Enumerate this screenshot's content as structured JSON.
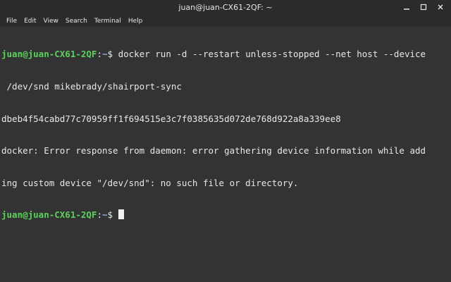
{
  "window": {
    "title": "juan@juan-CX61-2QF: ~",
    "buttons": {
      "minimize": "–",
      "maximize": "□",
      "close": "✕"
    }
  },
  "menu": {
    "items": [
      "File",
      "Edit",
      "View",
      "Search",
      "Terminal",
      "Help"
    ]
  },
  "terminal": {
    "prompt": {
      "user_host": "juan@juan-CX61-2QF",
      "colon": ":",
      "path": "~",
      "symbol": "$ "
    },
    "lines": {
      "cmd1": "docker run -d --restart unless-stopped --net host --device",
      "cmd1_wrap": " /dev/snd mikebrady/shairport-sync",
      "out1": "dbeb4f54cabd77c70959ff1f694515e3c7f0385635d072de768d922a8a339ee8",
      "out2": "docker: Error response from daemon: error gathering device information while add",
      "out3": "ing custom device \"/dev/snd\": no such file or directory."
    }
  },
  "colors": {
    "background": "#333333",
    "prompt_user": "#5ad15a",
    "prompt_path": "#8fb3e0"
  }
}
